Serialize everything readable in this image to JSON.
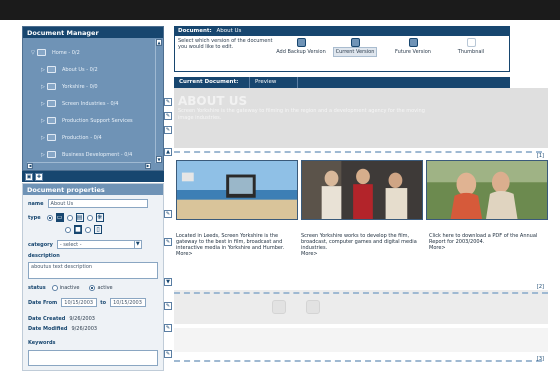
{
  "document_manager": {
    "title": "Document Manager",
    "tree": [
      {
        "label": "Home - 0/2",
        "level": 0
      },
      {
        "label": "About Us - 0/2",
        "level": 1
      },
      {
        "label": "Yorkshire - 0/0",
        "level": 1
      },
      {
        "label": "Screen Industries - 0/4",
        "level": 1
      },
      {
        "label": "Production Support Services",
        "level": 1
      },
      {
        "label": "Production - 0/4",
        "level": 1
      },
      {
        "label": "Business Development - 0/4",
        "level": 1
      }
    ]
  },
  "properties": {
    "title": "Document properties",
    "name_label": "name",
    "name_value": "About Us",
    "type_label": "type",
    "category_label": "category",
    "category_value": "- select -",
    "description_label": "description",
    "description_value": "aboutus text description",
    "status_label": "status",
    "status_options": [
      "inactive",
      "active"
    ],
    "date_from_label": "Date From",
    "date_from_value": "10/15/2003",
    "date_to_label": "to",
    "date_to_value": "10/15/2003",
    "created_label": "Date Created",
    "created_value": "9/26/2003",
    "modified_label": "Date Modified",
    "modified_value": "9/26/2003",
    "keywords_label": "Keywords"
  },
  "info_bar": {
    "title_prefix": "Document:",
    "title_doc": "About Us",
    "instruction": "Select which version of the document you would like to edit.",
    "versions": [
      {
        "label": "Add Backup Version",
        "active": false
      },
      {
        "label": "Current Version",
        "active": true
      },
      {
        "label": "Future Version",
        "active": false
      },
      {
        "label": "Thumbnail",
        "active": false
      }
    ]
  },
  "tabs": {
    "current": "Current Document:",
    "preview": "Preview"
  },
  "content": {
    "ghost_title": "ABOUT US",
    "ghost_text": "Screen Yorkshire is the gateway to filming in the region and a development agency for the moving image industries.",
    "captions": [
      "Located in Leeds, Screen Yorkshire is the gateway to the best in film, broadcast and interactive media in Yorkshire and Humber.",
      "Screen Yorkshire works to develop the film, broadcast, computer games and digital media industries.",
      "Click here to download a PDF of the Annual Report for 2003/2004."
    ],
    "more_label": "More>",
    "corner_marks": [
      "[1]",
      "[2]",
      "[3]"
    ]
  },
  "colors": {
    "navy": "#17466f",
    "steel": "#6f93b6",
    "panel_grey": "#dfdfdf"
  }
}
